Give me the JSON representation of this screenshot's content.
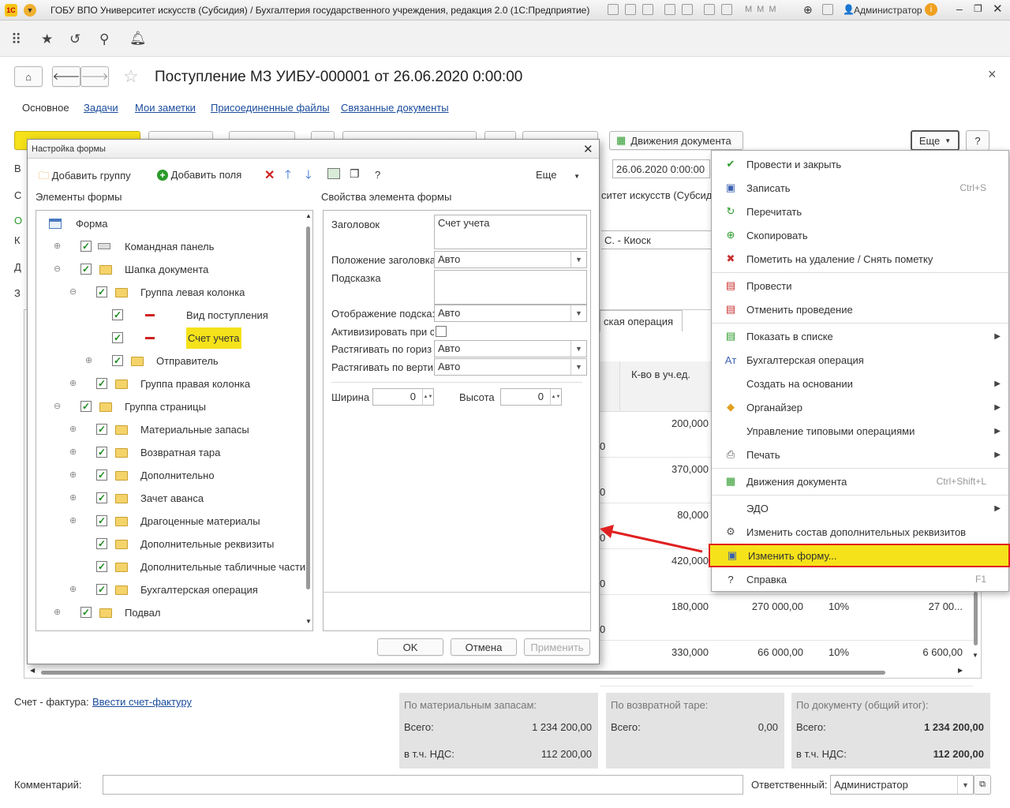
{
  "window": {
    "title": "ГОБУ ВПО Университет искусств (Субсидия) / Бухгалтерия государственного учреждения, редакция 2.0  (1С:Предприятие)",
    "user": "Администратор"
  },
  "doc": {
    "title": "Поступление МЗ УИБУ-000001 от 26.06.2020 0:00:00",
    "close": "×"
  },
  "tabs": [
    "Основное",
    "Задачи",
    "Мои заметки",
    "Присоединенные файлы",
    "Связанные документы"
  ],
  "cmd": {
    "movements": "Движения документа",
    "more": "Еще",
    "help": "?"
  },
  "header": {
    "date": "26.06.2020  0:00:00",
    "org": "ситет искусств (Субсиди",
    "sender": "С. - Киоск"
  },
  "table_fragment": {
    "tab": "ская операция",
    "qty_header": "К-во в уч.ед.",
    "rows": [
      {
        "qty": "200,000",
        "left": "0"
      },
      {
        "qty": "370,000",
        "left": "0"
      },
      {
        "qty": "80,000",
        "left": "0"
      },
      {
        "qty": "420,000",
        "left": "0"
      },
      {
        "qty": "180,000",
        "sum": "270 000,00",
        "vat": "10%",
        "vatsum": "27 00...",
        "left": "0"
      },
      {
        "qty": "330,000",
        "sum": "66 000,00",
        "vat": "10%",
        "vatsum": "6 600,00"
      }
    ]
  },
  "footer": {
    "invoice_label": "Счет - фактура:",
    "invoice_link": "Ввести счет-фактуру",
    "comment_label": "Комментарий:",
    "resp_label": "Ответственный:",
    "resp_value": "Администратор",
    "box1": {
      "title": "По материальным запасам:",
      "total_label": "Всего:",
      "total": "1 234 200,00",
      "vat_label": "в т.ч. НДС:",
      "vat": "112 200,00"
    },
    "box2": {
      "title": "По возвратной таре:",
      "total_label": "Всего:",
      "total": "0,00"
    },
    "box3": {
      "title": "По документу (общий итог):",
      "total_label": "Всего:",
      "total": "1 234 200,00",
      "vat_label": "в т.ч. НДС:",
      "vat": "112 200,00"
    }
  },
  "dialog": {
    "title": "Настройка формы",
    "add_group": "Добавить группу",
    "add_fields": "Добавить поля",
    "more": "Еще",
    "help": "?",
    "elements_label": "Элементы формы",
    "props_label": "Свойства элемента формы",
    "tree": [
      {
        "label": "Форма",
        "level": 0,
        "exp": "",
        "chk": false,
        "icon": "form"
      },
      {
        "label": "Командная панель",
        "level": 1,
        "exp": "⊕",
        "chk": true,
        "icon": "cmd"
      },
      {
        "label": "Шапка документа",
        "level": 1,
        "exp": "⊖",
        "chk": true,
        "icon": "folder"
      },
      {
        "label": "Группа левая колонка",
        "level": 2,
        "exp": "⊖",
        "chk": true,
        "icon": "folder"
      },
      {
        "label": "Вид поступления",
        "level": 3,
        "exp": "",
        "chk": true,
        "icon": "field"
      },
      {
        "label": "Счет учета",
        "level": 3,
        "exp": "",
        "chk": true,
        "icon": "field",
        "selected": true
      },
      {
        "label": "Отправитель",
        "level": 3,
        "exp": "⊕",
        "chk": true,
        "icon": "folder"
      },
      {
        "label": "Группа правая колонка",
        "level": 2,
        "exp": "⊕",
        "chk": true,
        "icon": "folder"
      },
      {
        "label": "Группа страницы",
        "level": 1,
        "exp": "⊖",
        "chk": true,
        "icon": "folder"
      },
      {
        "label": "Материальные запасы",
        "level": 2,
        "exp": "⊕",
        "chk": true,
        "icon": "folder"
      },
      {
        "label": "Возвратная тара",
        "level": 2,
        "exp": "⊕",
        "chk": true,
        "icon": "folder"
      },
      {
        "label": "Дополнительно",
        "level": 2,
        "exp": "⊕",
        "chk": true,
        "icon": "folder"
      },
      {
        "label": "Зачет аванса",
        "level": 2,
        "exp": "⊕",
        "chk": true,
        "icon": "folder"
      },
      {
        "label": "Драгоценные материалы",
        "level": 2,
        "exp": "⊕",
        "chk": true,
        "icon": "folder"
      },
      {
        "label": "Дополнительные реквизиты",
        "level": 2,
        "exp": "",
        "chk": true,
        "icon": "folder"
      },
      {
        "label": "Дополнительные табличные части",
        "level": 2,
        "exp": "",
        "chk": true,
        "icon": "folder"
      },
      {
        "label": "Бухгалтерская операция",
        "level": 2,
        "exp": "⊕",
        "chk": true,
        "icon": "folder"
      },
      {
        "label": "Подвал",
        "level": 1,
        "exp": "⊕",
        "chk": true,
        "icon": "folder"
      }
    ],
    "props": {
      "caption_label": "Заголовок",
      "caption_value": "Счет учета",
      "caption_pos_label": "Положение заголовка",
      "caption_pos_value": "Авто",
      "tooltip_label": "Подсказка",
      "tooltip_disp_label": "Отображение подска:",
      "tooltip_disp_value": "Авто",
      "activate_label": "Активизировать при с",
      "stretch_h_label": "Растягивать по гориз",
      "stretch_h_value": "Авто",
      "stretch_v_label": "Растягивать по верти",
      "stretch_v_value": "Авто",
      "width_label": "Ширина",
      "width_value": "0",
      "height_label": "Высота",
      "height_value": "0"
    },
    "ok": "OK",
    "cancel": "Отмена",
    "apply": "Применить"
  },
  "menu": {
    "items": [
      {
        "label": "Провести и закрыть",
        "icon": "✔",
        "color": "#2a9a2a"
      },
      {
        "label": "Записать",
        "shortcut": "Ctrl+S",
        "icon": "▣",
        "color": "#3b62b0"
      },
      {
        "label": "Перечитать",
        "icon": "↻",
        "color": "#2a9a2a"
      },
      {
        "label": "Скопировать",
        "icon": "⊕",
        "color": "#2a9a2a"
      },
      {
        "label": "Пометить на удаление / Снять пометку",
        "icon": "✖",
        "color": "#c83030",
        "sep_after": true
      },
      {
        "label": "Провести",
        "icon": "▤",
        "color": "#c83030"
      },
      {
        "label": "Отменить проведение",
        "icon": "▤",
        "color": "#c83030",
        "sep_after": true
      },
      {
        "label": "Показать в списке",
        "icon": "▤",
        "color": "#2a9a2a",
        "arrow": true
      },
      {
        "label": "Бухгалтерская операция",
        "icon": "Aт",
        "color": "#3b62b0"
      },
      {
        "label": "Создать на основании",
        "icon": "",
        "arrow": true
      },
      {
        "label": "Органайзер",
        "icon": "◆",
        "color": "#e0a020",
        "arrow": true
      },
      {
        "label": "Управление типовыми операциями",
        "icon": "",
        "arrow": true
      },
      {
        "label": "Печать",
        "icon": "⎙",
        "color": "#555",
        "arrow": true,
        "sep_after": true
      },
      {
        "label": "Движения документа",
        "shortcut": "Ctrl+Shift+L",
        "icon": "▦",
        "color": "#2a9a2a",
        "sep_after": true
      },
      {
        "label": "ЭДО",
        "icon": "",
        "arrow": true
      },
      {
        "label": "Изменить состав дополнительных реквизитов",
        "icon": "⚙",
        "color": "#555"
      },
      {
        "label": "Изменить форму...",
        "icon": "▣",
        "color": "#3b62b0",
        "highlight": true
      },
      {
        "label": "Справка",
        "shortcut": "F1",
        "icon": "?",
        "color": "#333"
      }
    ]
  },
  "colors": {
    "accent_yellow": "#f5e21a",
    "highlight_border": "#e02020",
    "arrow": "#e02020"
  }
}
